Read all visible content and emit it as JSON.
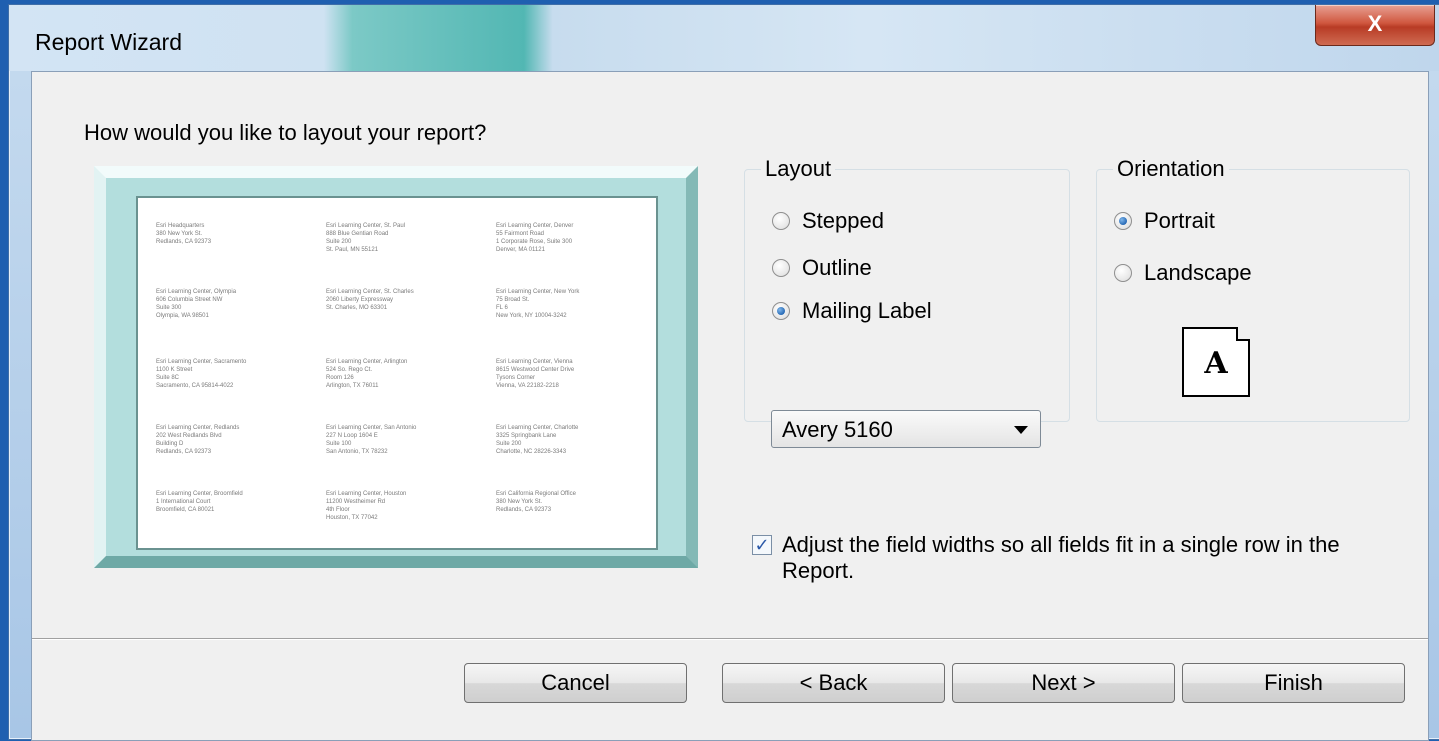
{
  "window": {
    "title": "Report Wizard",
    "close_label": "X"
  },
  "prompt": "How would you like to layout your report?",
  "preview_labels": [
    [
      "Esri Headquarters",
      "380 New York St.",
      "Redlands, CA 92373"
    ],
    [
      "Esri Learning Center, St. Paul",
      "888 Blue Gentian Road",
      "Suite 200",
      "St. Paul, MN 55121"
    ],
    [
      "Esri Learning Center, Denver",
      "55 Fairmont Road",
      "1 Corporate Rose, Suite 300",
      "Denver, MA 01121"
    ],
    [
      "Esri Learning Center, Olympia",
      "606 Columbia Street NW",
      "Suite 300",
      "Olympia, WA 98501"
    ],
    [
      "Esri Learning Center, St. Charles",
      "2060 Liberty Expressway",
      "St. Charles, MO 63301"
    ],
    [
      "Esri Learning Center, New York",
      "75 Broad St.",
      "FL 6",
      "New York, NY 10004-3242"
    ],
    [
      "Esri Learning Center, Sacramento",
      "1100 K Street",
      "Suite 8C",
      "Sacramento, CA 95814-4022"
    ],
    [
      "Esri Learning Center, Arlington",
      "524 So. Rego Ct.",
      "Room 126",
      "Arlington, TX 76011"
    ],
    [
      "Esri Learning Center, Vienna",
      "8615 Westwood Center Drive",
      "Tysons Corner",
      "Vienna, VA 22182-2218"
    ],
    [
      "Esri Learning Center, Redlands",
      "202 West Redlands Blvd",
      "Building D",
      "Redlands, CA 92373"
    ],
    [
      "Esri Learning Center, San Antonio",
      "227 N Loop 1604 E",
      "Suite 100",
      "San Antonio, TX 78232"
    ],
    [
      "Esri Learning Center, Charlotte",
      "3325 Springbank Lane",
      "Suite 200",
      "Charlotte, NC 28226-3343"
    ],
    [
      "Esri Learning Center, Broomfield",
      "1 International Court",
      "Broomfield, CA 80021"
    ],
    [
      "Esri Learning Center, Houston",
      "11200 Westheimer Rd",
      "4th Floor",
      "Houston, TX 77042"
    ],
    [
      "Esri California Regional Office",
      "380 New York St.",
      "Redlands, CA 92373"
    ]
  ],
  "layout": {
    "legend": "Layout",
    "options": [
      {
        "label": "Stepped",
        "selected": false
      },
      {
        "label": "Outline",
        "selected": false
      },
      {
        "label": "Mailing Label",
        "selected": true
      }
    ],
    "label_type": "Avery 5160"
  },
  "orientation": {
    "legend": "Orientation",
    "options": [
      {
        "label": "Portrait",
        "selected": true
      },
      {
        "label": "Landscape",
        "selected": false
      }
    ],
    "page_glyph": "A"
  },
  "adjust_fields": {
    "checked": true,
    "label": "Adjust the field widths so all fields fit in a single row in the Report."
  },
  "buttons": {
    "cancel": "Cancel",
    "back": "< Back",
    "next": "Next >",
    "finish": "Finish"
  }
}
